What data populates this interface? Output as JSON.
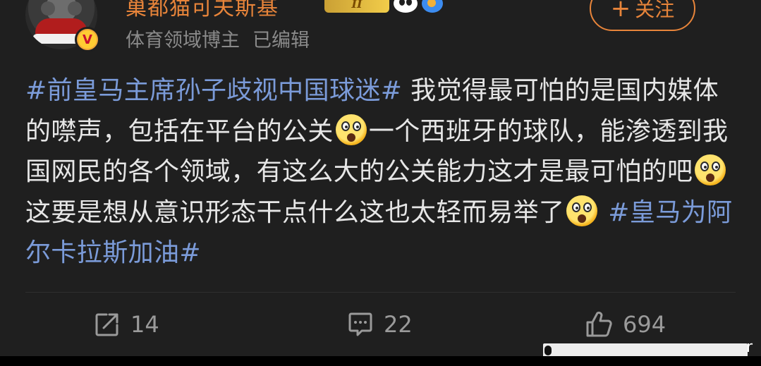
{
  "header": {
    "username": "巢都猫可夫斯基",
    "level_badge": "II",
    "user_tag": "体育领域博主",
    "edited_label": "已编辑",
    "follow_label": "关注",
    "follow_plus": "+",
    "verified_mark": "V"
  },
  "post": {
    "segments": [
      {
        "type": "hashtag",
        "text": "#前皇马主席孙子歧视中国球迷#"
      },
      {
        "type": "text",
        "text": " 我觉得最可怕的是国内媒体的噤声，包括在平台的公关"
      },
      {
        "type": "emoji",
        "name": "surprised-face"
      },
      {
        "type": "text",
        "text": "一个西班牙的球队，能渗透到我国网民的各个领域，有这么大的公关能力这才是最可怕的吧"
      },
      {
        "type": "emoji",
        "name": "surprised-face"
      },
      {
        "type": "text",
        "text": "这要是想从意识形态干点什么这也太轻而易举了"
      },
      {
        "type": "emoji",
        "name": "surprised-face"
      },
      {
        "type": "text",
        "text": " "
      },
      {
        "type": "hashtag",
        "text": "#皇马为阿尔卡拉斯加油#"
      }
    ]
  },
  "actions": {
    "share_count": "14",
    "comment_count": "22",
    "like_count": "694"
  },
  "overlay": {
    "letter": "r"
  },
  "colors": {
    "background": "#1f1f1f",
    "username": "#e7843a",
    "hashtag": "#7b9bd9",
    "body_text": "#e6e6e6",
    "meta_text": "#8a8a8a",
    "action_text": "#9a9a9a"
  }
}
